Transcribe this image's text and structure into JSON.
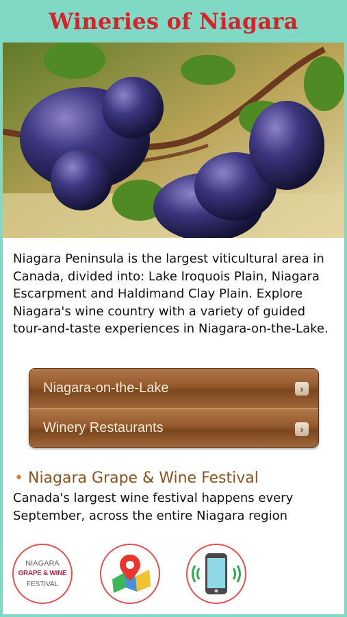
{
  "header": {
    "title": "Wineries of Niagara"
  },
  "intro": {
    "text": "Niagara Peninsula is the largest viticultural area in Canada, divided into: Lake Iroquois Plain, Niagara Escarpment and Haldimand Clay Plain. Explore Niagara's wine country with a variety of guided tour-and-taste experiences in Niagara-on-the-Lake."
  },
  "menu": {
    "items": [
      {
        "label": "Niagara-on-the-Lake",
        "chevron": "›"
      },
      {
        "label": "Winery Restaurants",
        "chevron": "›"
      }
    ]
  },
  "festival": {
    "bullet": "•",
    "title": "Niagara Grape & Wine Festival",
    "text": "Canada's largest wine festival happens every September, across the entire Niagara region"
  },
  "icons": {
    "festival_logo": {
      "line1": "NIAGARA",
      "line2": "GRAPE & WINE",
      "line3": "FESTIVAL",
      "icon": "festival-logo-icon"
    },
    "map": {
      "icon": "map-pin-icon"
    },
    "phone": {
      "icon": "phone-vibrate-icon"
    }
  },
  "colors": {
    "title": "#d6222a",
    "frame": "#7fd9c4",
    "menu": "#94592c",
    "festival_title": "#8a5220",
    "icon_border": "#e25050"
  }
}
